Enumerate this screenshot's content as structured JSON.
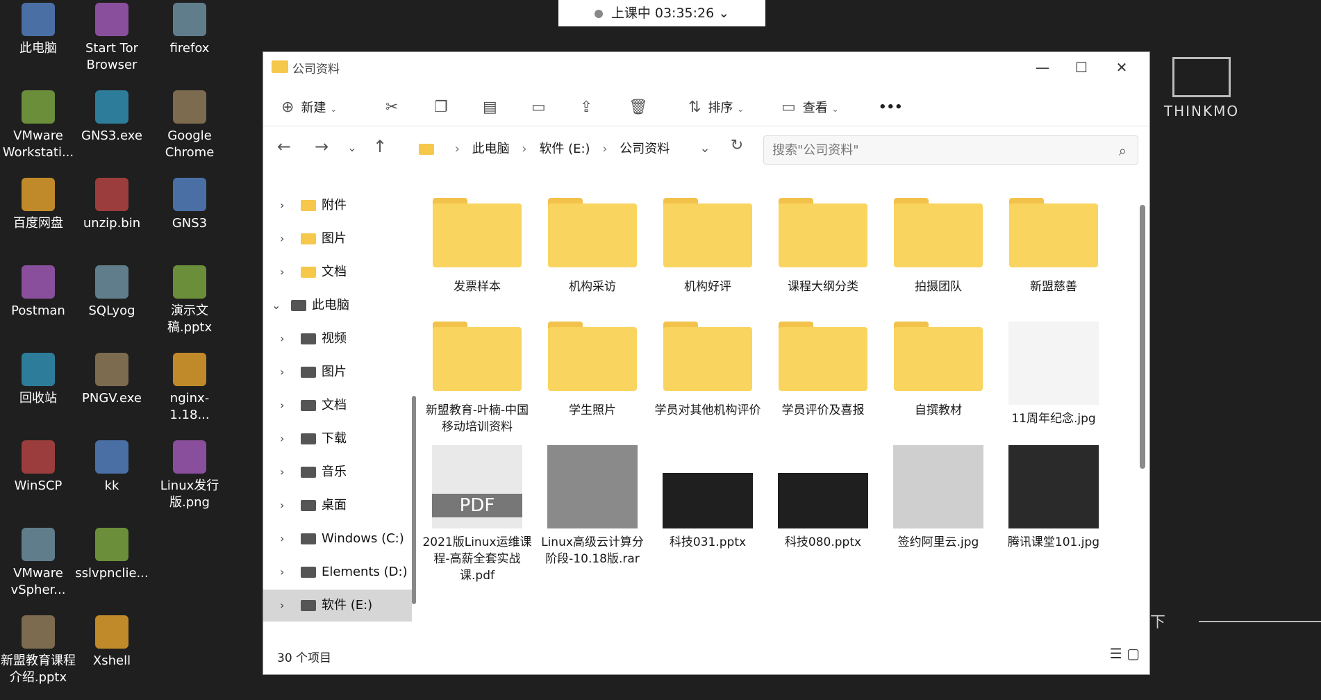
{
  "timer": {
    "text": "上课中 03:35:26 ⌄"
  },
  "desktop": {
    "col1": [
      "此电脑",
      "VMware Workstati...",
      "百度网盘",
      "Postman",
      "回收站",
      "WinSCP",
      "VMware vSpher...",
      "新盟教育课程介绍.pptx"
    ],
    "col2": [
      "Start Tor Browser",
      "GNS3.exe",
      "unzip.bin",
      "SQLyog",
      "PNGV.exe",
      "kk",
      "sslvpnclie...",
      "Xshell"
    ],
    "col3": [
      "firefox",
      "Google Chrome",
      "GNS3",
      "演示文稿.pptx",
      "nginx-1.18...",
      "Linux发行版.png"
    ]
  },
  "window": {
    "title": "公司资料",
    "min": "—",
    "max": "☐",
    "close": "✕",
    "toolbar": {
      "new": "新建",
      "sort": "排序",
      "view": "查看",
      "more": "•••"
    },
    "breadcrumb": [
      "此电脑",
      "软件 (E:)",
      "公司资料"
    ],
    "search_placeholder": "搜索\"公司资料\"",
    "sidebar": [
      {
        "label": "附件",
        "icon": "folder",
        "indent": 1
      },
      {
        "label": "图片",
        "icon": "folder",
        "indent": 1
      },
      {
        "label": "文档",
        "icon": "folder",
        "indent": 1
      },
      {
        "label": "此电脑",
        "icon": "pc",
        "indent": 0
      },
      {
        "label": "视频",
        "icon": "video",
        "indent": 1
      },
      {
        "label": "图片",
        "icon": "picture",
        "indent": 1
      },
      {
        "label": "文档",
        "icon": "doc",
        "indent": 1
      },
      {
        "label": "下载",
        "icon": "download",
        "indent": 1
      },
      {
        "label": "音乐",
        "icon": "music",
        "indent": 1
      },
      {
        "label": "桌面",
        "icon": "desktop",
        "indent": 1
      },
      {
        "label": "Windows (C:)",
        "icon": "drive",
        "indent": 1
      },
      {
        "label": "Elements (D:)",
        "icon": "drive",
        "indent": 1
      },
      {
        "label": "软件 (E:)",
        "icon": "drive",
        "indent": 1
      }
    ],
    "items": [
      {
        "label": "发票样本",
        "kind": "folder"
      },
      {
        "label": "机构采访",
        "kind": "folder"
      },
      {
        "label": "机构好评",
        "kind": "folder"
      },
      {
        "label": "课程大纲分类",
        "kind": "folder"
      },
      {
        "label": "拍摄团队",
        "kind": "folder"
      },
      {
        "label": "新盟慈善",
        "kind": "folder"
      },
      {
        "label": "新盟教育-叶楠-中国移动培训资料",
        "kind": "folder"
      },
      {
        "label": "学生照片",
        "kind": "folder"
      },
      {
        "label": "学员对其他机构评价",
        "kind": "folder"
      },
      {
        "label": "学员评价及喜报",
        "kind": "folder"
      },
      {
        "label": "自撰教材",
        "kind": "folder"
      },
      {
        "label": "11周年纪念.jpg",
        "kind": "jpg-logo"
      },
      {
        "label": "2021版Linux运维课程-高薪全套实战课.pdf",
        "kind": "pdf"
      },
      {
        "label": "Linux高级云计算分阶段-10.18版.rar",
        "kind": "rar"
      },
      {
        "label": "科技031.pptx",
        "kind": "pptx"
      },
      {
        "label": "科技080.pptx",
        "kind": "pptx"
      },
      {
        "label": "签约阿里云.jpg",
        "kind": "jpg-paper"
      },
      {
        "label": "腾讯课堂101.jpg",
        "kind": "jpg-cert"
      }
    ],
    "status": "30 个项目"
  },
  "logo_text": "THINKMO",
  "lower_text": "下"
}
